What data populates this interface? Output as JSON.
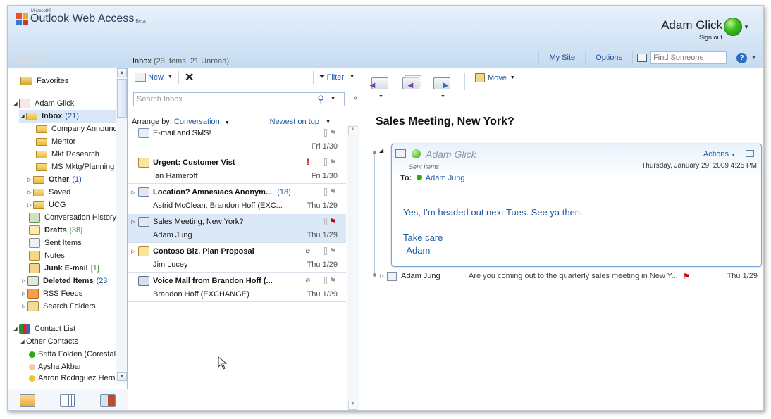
{
  "header": {
    "brand_small": "Microsoft®",
    "brand": "Outlook Web Access",
    "beta": "Beta",
    "user_name": "Adam Glick",
    "sign_out": "Sign out",
    "mail_title": "Mail",
    "nav_links": [
      "My Site",
      "Options"
    ],
    "find_placeholder": "Find Someone"
  },
  "sidebar": {
    "items": [
      {
        "label": "Favorites",
        "count": ""
      },
      {
        "label": "Adam Glick",
        "count": ""
      },
      {
        "label": "Inbox",
        "count": "(21)"
      },
      {
        "label": "Company Announc",
        "count": ""
      },
      {
        "label": "Mentor",
        "count": ""
      },
      {
        "label": "Mkt Research",
        "count": ""
      },
      {
        "label": "MS Mktg/Planning",
        "count": ""
      },
      {
        "label": "Other",
        "count": "(1)"
      },
      {
        "label": "Saved",
        "count": ""
      },
      {
        "label": "UCG",
        "count": ""
      },
      {
        "label": "Conversation History",
        "count": ""
      },
      {
        "label": "Drafts",
        "count": "[38]"
      },
      {
        "label": "Sent Items",
        "count": ""
      },
      {
        "label": "Notes",
        "count": ""
      },
      {
        "label": "Junk E-mail",
        "count": "[1]"
      },
      {
        "label": "Deleted Items",
        "count": "(23"
      },
      {
        "label": "RSS Feeds",
        "count": ""
      },
      {
        "label": "Search Folders",
        "count": ""
      },
      {
        "label": "Contact List",
        "count": ""
      },
      {
        "label": "Other Contacts",
        "count": ""
      },
      {
        "label": "Britta Folden (Corestal",
        "count": ""
      },
      {
        "label": "Aysha Akbar",
        "count": ""
      },
      {
        "label": "Aaron Rodriguez Hern",
        "count": ""
      }
    ]
  },
  "list": {
    "folder": "Inbox",
    "folder_info": "(23 Items,  21  Unread)",
    "new_label": "New",
    "filter_label": "Filter",
    "search_placeholder": "Search Inbox",
    "arrange_by": "Arrange by:",
    "arrange_value": "Conversation",
    "sort_value": "Newest on top",
    "messages": [
      {
        "subject": "E-mail and SMS!",
        "from": "",
        "date": "Fri 1/30",
        "count": ""
      },
      {
        "subject": "Urgent: Customer Vist",
        "from": "Ian Hameroff",
        "date": "Fri 1/30",
        "count": ""
      },
      {
        "subject": "Location? Amnesiacs Anonym...",
        "from": "Astrid McClean; Brandon Hoff (EXC...",
        "date": "Thu 1/29",
        "count": "(18)"
      },
      {
        "subject": "Sales Meeting, New York?",
        "from": "Adam Jung",
        "date": "Thu 1/29",
        "count": ""
      },
      {
        "subject": "Contoso Biz. Plan Proposal",
        "from": "Jim Lucey",
        "date": "Thu 1/29",
        "count": ""
      },
      {
        "subject": "Voice Mail from Brandon Hoff (...",
        "from": "Brandon Hoff (EXCHANGE)",
        "date": "Thu 1/29",
        "count": ""
      }
    ]
  },
  "reading": {
    "move_label": "Move",
    "subject": "Sales Meeting, New York?",
    "from": "Adam Glick",
    "folder": "Sent Items",
    "date": "Thursday, January 29, 2009 4:25 PM",
    "to_label": "To:",
    "to": "Adam Jung",
    "actions_label": "Actions",
    "body": [
      "Yes, I’m headed out next Tues.  See ya then.",
      "",
      "Take care",
      "-Adam"
    ],
    "reply": {
      "from": "Adam Jung",
      "preview": "Are you coming out to the quarterly sales meeting in New Y...",
      "date": "Thu 1/29"
    }
  },
  "colors": {
    "accent": "#1d5aa6",
    "presence": "#2aa816",
    "selection": "#d9e7f7",
    "flag": "#cc0000"
  }
}
